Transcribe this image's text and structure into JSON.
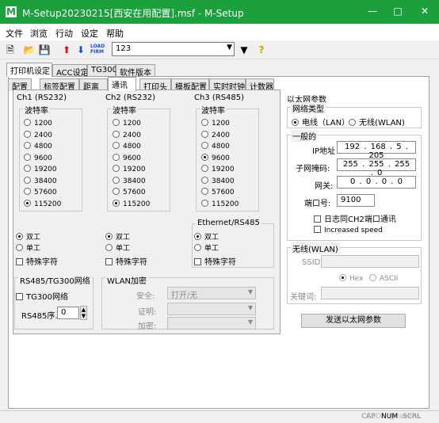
{
  "window": {
    "title": "M-Setup20230215[西安在用配置].msf - M-Setup",
    "icon_letter": "M"
  },
  "menu": [
    "文件",
    "浏览",
    "行动",
    "设定",
    "帮助"
  ],
  "toolbar": {
    "combo_value": "123",
    "icons": [
      "new-icon",
      "open-icon",
      "save-icon",
      "upload-icon",
      "download-icon",
      "load-firmware-icon",
      "filter-icon",
      "help-icon"
    ]
  },
  "tabs_top": [
    "打印机设定",
    "ACC设定",
    "TG300",
    "软件版本"
  ],
  "tabs_sub": [
    "配置",
    "标签配置",
    "距离",
    "通讯",
    "打印头",
    "模板配置",
    "实时时钟",
    "计数器"
  ],
  "ch1": {
    "title": "Ch1 (RS232)",
    "baud_label": "波特率",
    "bauds": [
      "1200",
      "2400",
      "4800",
      "9600",
      "19200",
      "38400",
      "57600",
      "115200"
    ],
    "selected": "115200",
    "duplex_full": "双工",
    "duplex_half": "单工",
    "special": "特殊字符"
  },
  "ch2": {
    "title": "Ch2 (RS232)",
    "baud_label": "波特率",
    "bauds": [
      "1200",
      "2400",
      "4800",
      "9600",
      "19200",
      "38400",
      "57600",
      "115200"
    ],
    "selected": "115200",
    "duplex_full": "双工",
    "duplex_half": "单工",
    "special": "特殊字符"
  },
  "ch3": {
    "title": "Ch3 (RS485)",
    "baud_label": "波特率",
    "bauds": [
      "1200",
      "2400",
      "4800",
      "9600",
      "19200",
      "38400",
      "57600",
      "115200"
    ],
    "selected": "9600"
  },
  "eth485": {
    "title": "Ethernet/RS485",
    "duplex_full": "双工",
    "duplex_half": "单工",
    "special": "特殊字符"
  },
  "rs485tg": {
    "title": "RS485/TG300网络",
    "tg300": "TG300网络",
    "seq_label": "RS485序...",
    "seq_value": "0"
  },
  "wlan": {
    "title": "WLAN加密",
    "security_label": "安全:",
    "security_value": "打开/无",
    "cert_label": "证明:",
    "enc_label": "加密:"
  },
  "ethernet": {
    "title": "以太网参数",
    "net_type_label": "网络类型",
    "wired": "电线（LAN）",
    "wireless": "无线(WLAN)",
    "general_label": "一般的",
    "ip_label": "IP地址",
    "ip": [
      "192",
      "168",
      "5",
      "205"
    ],
    "mask_label": "子网掩码:",
    "mask": [
      "255",
      "255",
      "255",
      "0"
    ],
    "gw_label": "网关:",
    "gw": [
      "0",
      "0",
      "0",
      "0"
    ],
    "port_label": "端口号:",
    "port": "9100",
    "log_ch2": "日志同CH2端口通讯",
    "increased_speed": "Increased speed"
  },
  "wireless": {
    "title": "无线(WLAN)",
    "ssid_label": "SSID:",
    "hex": "Hex",
    "ascii": "ASCII",
    "key_label": "关键词:",
    "send_button": "发送以太网参数"
  },
  "status": {
    "cap": "CAP",
    "num": "NUM",
    "scrl": "SCRL",
    "watermark": "CSDN @raeens"
  }
}
